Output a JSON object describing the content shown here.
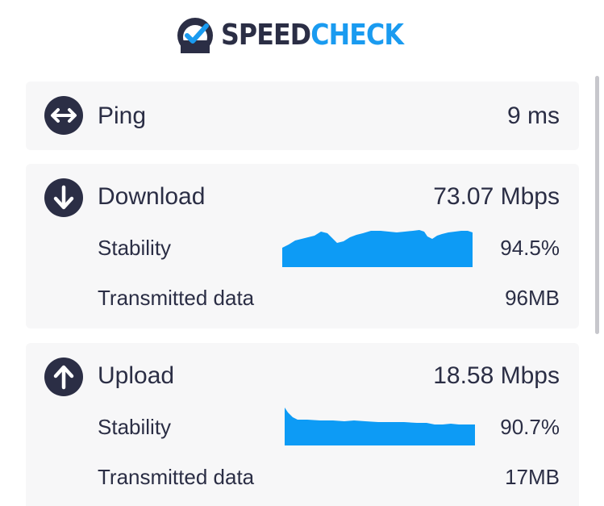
{
  "brand": {
    "part1": "SPEED",
    "part2": "CHECK",
    "dark_color": "#2b2e45",
    "accent_color": "#1a9bf0"
  },
  "ping": {
    "label": "Ping",
    "value": "9 ms",
    "icon": "double-arrow-icon"
  },
  "download": {
    "label": "Download",
    "value": "73.07 Mbps",
    "icon": "arrow-down-circle-icon",
    "stability_label": "Stability",
    "stability_value": "94.5%",
    "transmitted_label": "Transmitted data",
    "transmitted_value": "96MB"
  },
  "upload": {
    "label": "Upload",
    "value": "18.58 Mbps",
    "icon": "arrow-up-circle-icon",
    "stability_label": "Stability",
    "stability_value": "90.7%",
    "transmitted_label": "Transmitted data",
    "transmitted_value": "17MB"
  },
  "graph_color": "#0d9bf5"
}
